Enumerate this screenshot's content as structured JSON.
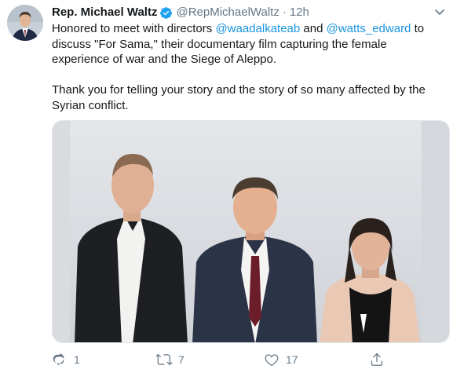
{
  "tweet": {
    "author": {
      "name": "Rep. Michael Waltz",
      "handle": "@RepMichaelWaltz",
      "verified": true
    },
    "separator": "·",
    "time": "12h",
    "text": {
      "p1_a": "Honored to meet with directors ",
      "mention1": "@waadalkateab",
      "p1_b": " and ",
      "mention2": "@watts_edward",
      "p1_c": " to discuss \"For Sama,\" their documentary film capturing the female experience of war and the Siege of Aleppo.",
      "p2": "Thank you for telling your story and the story of so many affected by the Syrian conflict."
    },
    "actions": {
      "replies": "1",
      "retweets": "7",
      "likes": "17"
    }
  },
  "icons": {
    "verified": "verified-badge-icon",
    "more": "chevron-down-icon",
    "reply": "reply-icon",
    "retweet": "retweet-icon",
    "like": "heart-icon",
    "share": "share-icon"
  },
  "colors": {
    "accent": "#1b95e0",
    "verified": "#1da1f2",
    "muted": "#657786",
    "text": "#14171a"
  }
}
